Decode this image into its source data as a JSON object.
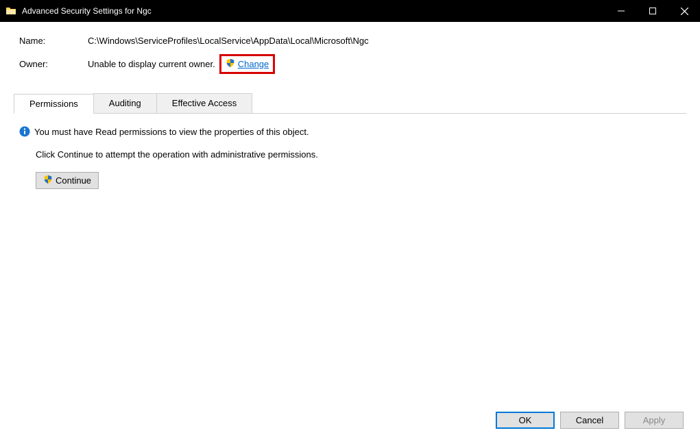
{
  "titlebar": {
    "title": "Advanced Security Settings for Ngc"
  },
  "header": {
    "name_label": "Name:",
    "name_value": "C:\\Windows\\ServiceProfiles\\LocalService\\AppData\\Local\\Microsoft\\Ngc",
    "owner_label": "Owner:",
    "owner_value": "Unable to display current owner.",
    "change_link": "Change"
  },
  "tabs": {
    "permissions": "Permissions",
    "auditing": "Auditing",
    "effective": "Effective Access"
  },
  "panel": {
    "info_text": "You must have Read permissions to view the properties of this object.",
    "sub_text": "Click Continue to attempt the operation with administrative permissions.",
    "continue_label": "Continue"
  },
  "footer": {
    "ok": "OK",
    "cancel": "Cancel",
    "apply": "Apply"
  }
}
